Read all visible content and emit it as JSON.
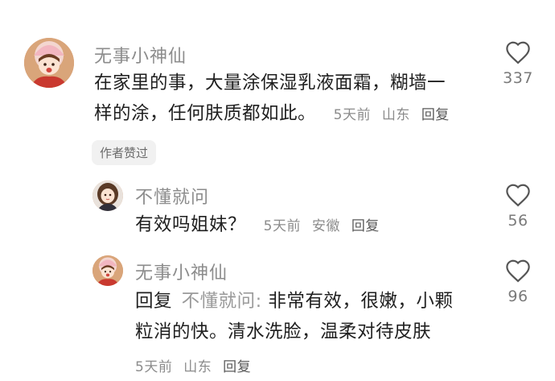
{
  "comments": [
    {
      "username": "无事小神仙",
      "text_line1": "在家里的事，大量涂保湿乳液面霜，糊墙一",
      "text_line2": "样的涂，任何肤质都如此。",
      "time": "5天前",
      "location": "山东",
      "reply_label": "回复",
      "likes": "337",
      "badge": "作者赞过",
      "avatar_icon": "avatar-girl-pink-hat"
    },
    {
      "username": "不懂就问",
      "text": "有效吗姐妹？",
      "time": "5天前",
      "location": "安徽",
      "reply_label": "回复",
      "likes": "56",
      "avatar_icon": "avatar-girl-brown-hair"
    },
    {
      "username": "无事小神仙",
      "reply_prefix": "回复",
      "reply_to": "不懂就问:",
      "text_line1": "非常有效，很嫩，小颗",
      "text_line2": "粒消的快。清水洗脸，温柔对待皮肤",
      "time": "5天前",
      "location": "山东",
      "reply_label": "回复",
      "likes": "96",
      "avatar_icon": "avatar-girl-pink-hat"
    }
  ],
  "icons": {
    "like": "heart-outline-icon"
  },
  "colors": {
    "muted": "#8c8c8c",
    "text": "#1f1f1f",
    "badge_bg": "#f1f1f1"
  }
}
